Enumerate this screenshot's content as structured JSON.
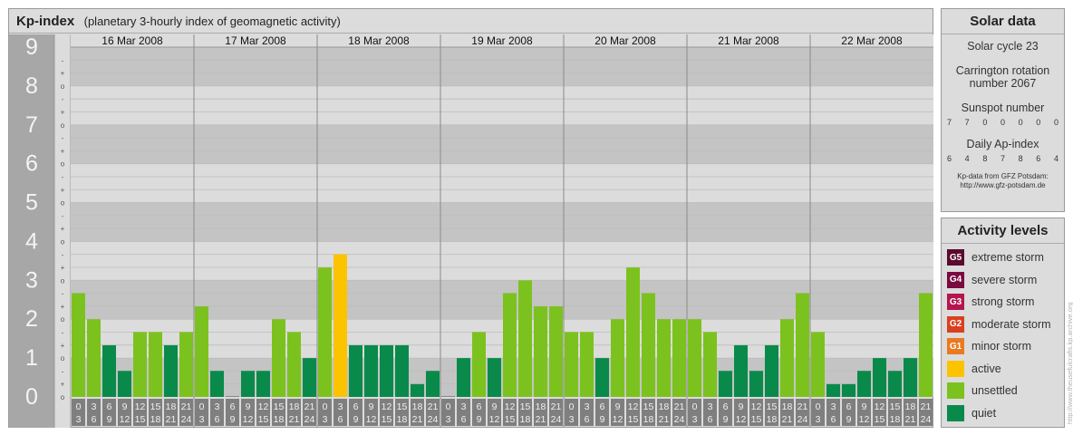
{
  "header": {
    "title": "Kp-index",
    "subtitle": "(planetary 3-hourly index of geomagnetic activity)"
  },
  "chart_data": {
    "type": "bar",
    "title": "Kp-index",
    "ylim": [
      0,
      9
    ],
    "y_ticks": [
      "0",
      "1",
      "2",
      "3",
      "4",
      "5",
      "6",
      "7",
      "8",
      "9"
    ],
    "minor_tick_labels": [
      "o",
      "+",
      "-"
    ],
    "days": [
      "16 Mar 2008",
      "17 Mar 2008",
      "18 Mar 2008",
      "19 Mar 2008",
      "20 Mar 2008",
      "21 Mar 2008",
      "22 Mar 2008"
    ],
    "interval_start_labels": [
      "0",
      "3",
      "6",
      "9",
      "12",
      "15",
      "18",
      "21"
    ],
    "interval_end_labels": [
      "3",
      "6",
      "9",
      "12",
      "15",
      "18",
      "21",
      "24"
    ],
    "values": [
      [
        2.67,
        2.0,
        1.33,
        0.67,
        1.67,
        1.67,
        1.33,
        1.67
      ],
      [
        2.33,
        0.67,
        0.0,
        0.67,
        0.67,
        2.0,
        1.67,
        1.0
      ],
      [
        3.33,
        3.67,
        1.33,
        1.33,
        1.33,
        1.33,
        0.33,
        0.67
      ],
      [
        0.0,
        1.0,
        1.67,
        1.0,
        2.67,
        3.0,
        2.33,
        2.33
      ],
      [
        1.67,
        1.67,
        1.0,
        2.0,
        3.33,
        2.67,
        2.0,
        2.0
      ],
      [
        2.0,
        1.67,
        0.67,
        1.33,
        0.67,
        1.33,
        2.0,
        2.67
      ],
      [
        1.67,
        0.33,
        0.33,
        0.67,
        1.0,
        0.67,
        1.0,
        2.67
      ]
    ],
    "levels": [
      [
        "unsettled",
        "unsettled",
        "quiet",
        "quiet",
        "unsettled",
        "unsettled",
        "quiet",
        "unsettled"
      ],
      [
        "unsettled",
        "quiet",
        "quiet",
        "quiet",
        "quiet",
        "unsettled",
        "unsettled",
        "quiet"
      ],
      [
        "unsettled",
        "active",
        "quiet",
        "quiet",
        "quiet",
        "quiet",
        "quiet",
        "quiet"
      ],
      [
        "quiet",
        "quiet",
        "unsettled",
        "quiet",
        "unsettled",
        "unsettled",
        "unsettled",
        "unsettled"
      ],
      [
        "unsettled",
        "unsettled",
        "quiet",
        "unsettled",
        "unsettled",
        "unsettled",
        "unsettled",
        "unsettled"
      ],
      [
        "unsettled",
        "unsettled",
        "quiet",
        "quiet",
        "quiet",
        "quiet",
        "unsettled",
        "unsettled"
      ],
      [
        "unsettled",
        "quiet",
        "quiet",
        "quiet",
        "quiet",
        "quiet",
        "quiet",
        "unsettled"
      ]
    ],
    "colors": {
      "quiet": "#0a8a4a",
      "unsettled": "#7cc21e",
      "active": "#fcc300",
      "band_dark": "#c4c4c4",
      "band_light": "#dcdcdc",
      "axis_bg": "#a7a7a7",
      "label_bg": "#7f7f7f"
    }
  },
  "solar": {
    "title": "Solar data",
    "cycle": "Solar cycle 23",
    "carrington_l1": "Carrington rotation",
    "carrington_l2": "number 2067",
    "sunspot_title": "Sunspot number",
    "sunspot_values": [
      "7",
      "7",
      "0",
      "0",
      "0",
      "0",
      "0"
    ],
    "ap_title": "Daily Ap-index",
    "ap_values": [
      "6",
      "4",
      "8",
      "7",
      "8",
      "6",
      "4"
    ],
    "footer_l1": "Kp-data from GFZ Potsdam:",
    "footer_l2": "http://www.gfz-potsdam.de"
  },
  "activity": {
    "title": "Activity levels",
    "items": [
      {
        "code": "G5",
        "label": "extreme storm",
        "color": "#5a0a2e"
      },
      {
        "code": "G4",
        "label": "severe storm",
        "color": "#7a0a40"
      },
      {
        "code": "G3",
        "label": "strong storm",
        "color": "#b5154f"
      },
      {
        "code": "G2",
        "label": "moderate storm",
        "color": "#d9401f"
      },
      {
        "code": "G1",
        "label": "minor storm",
        "color": "#ea7a1f"
      },
      {
        "code": "",
        "label": "active",
        "color": "#fcc300"
      },
      {
        "code": "",
        "label": "unsettled",
        "color": "#7cc21e"
      },
      {
        "code": "",
        "label": "quiet",
        "color": "#0a8a4a"
      }
    ]
  },
  "watermark": "http://www.theusefulcrafts.kp.archive.org"
}
